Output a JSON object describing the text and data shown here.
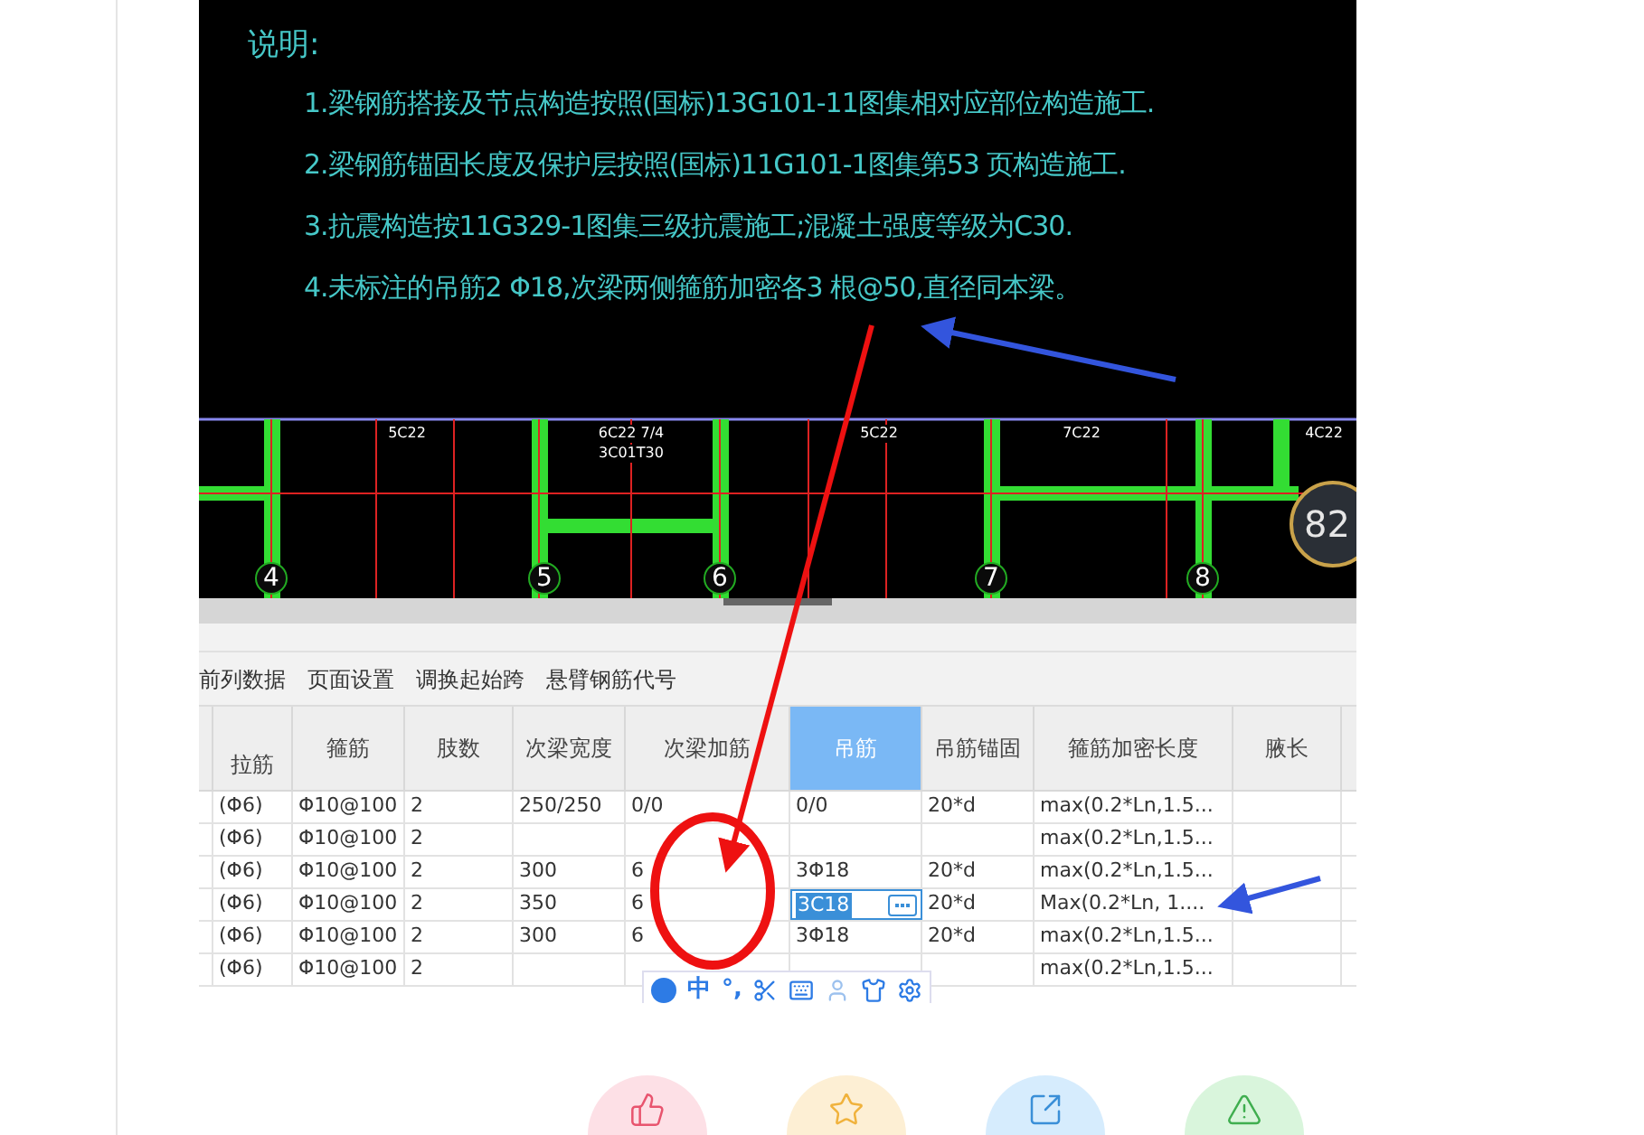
{
  "notes": {
    "title": "说明:",
    "items": [
      "1.梁钢筋搭接及节点构造按照(国标)13G101-11图集相对应部位构造施工.",
      "2.梁钢筋锚固长度及保护层按照(国标)11G101-1图集第53 页构造施工.",
      "3.抗震构造按11G329-1图集三级抗震施工;混凝土强度等级为C30.",
      "4.未标注的吊筋2 Φ18,次梁两侧箍筋加密各3 根@50,直径同本梁。"
    ]
  },
  "cad": {
    "labels": [
      "5C22",
      "6C22 7/4",
      "3C01T30",
      "5C22",
      "7C22",
      "4C22"
    ],
    "axes": [
      "4",
      "5",
      "6",
      "7",
      "8"
    ],
    "gauge": "82"
  },
  "toolbar": [
    "前列数据",
    "页面设置",
    "调换起始跨",
    "悬臂钢筋代号"
  ],
  "table": {
    "columns": [
      {
        "label": "拉筋",
        "selected": false
      },
      {
        "label": "箍筋",
        "selected": false
      },
      {
        "label": "肢数",
        "selected": false
      },
      {
        "label": "次梁宽度",
        "selected": false
      },
      {
        "label": "次梁加筋",
        "selected": false
      },
      {
        "label": "吊筋",
        "selected": true
      },
      {
        "label": "吊筋锚固",
        "selected": false
      },
      {
        "label": "箍筋加密长度",
        "selected": false
      },
      {
        "label": "腋长",
        "selected": false
      }
    ],
    "rows": [
      {
        "editing": false,
        "cells": [
          "(Φ6)",
          "Φ10@100",
          "2",
          "250/250",
          "0/0",
          "0/0",
          "20*d",
          "max(0.2*Ln,1.5...",
          null
        ]
      },
      {
        "editing": false,
        "cells": [
          "(Φ6)",
          "Φ10@100",
          "2",
          null,
          null,
          null,
          null,
          "max(0.2*Ln,1.5...",
          null
        ]
      },
      {
        "editing": false,
        "cells": [
          "(Φ6)",
          "Φ10@100",
          "2",
          "300",
          "6",
          "3Φ18",
          "20*d",
          "max(0.2*Ln,1.5...",
          null
        ]
      },
      {
        "editing": true,
        "cells": [
          "(Φ6)",
          "Φ10@100",
          "2",
          "350",
          "6",
          "3C18",
          "20*d",
          "Max(0.2*Ln, 1....",
          null
        ]
      },
      {
        "editing": false,
        "cells": [
          "(Φ6)",
          "Φ10@100",
          "2",
          "300",
          "6",
          "3Φ18",
          "20*d",
          "max(0.2*Ln,1.5...",
          null
        ]
      },
      {
        "editing": false,
        "cells": [
          "(Φ6)",
          "Φ10@100",
          "2",
          null,
          null,
          null,
          null,
          "max(0.2*Ln,1.5...",
          null
        ]
      }
    ]
  },
  "ime": {
    "mode": "中",
    "punctuation": "°,"
  },
  "actions": [
    {
      "kind": "like"
    },
    {
      "kind": "favorite"
    },
    {
      "kind": "share"
    },
    {
      "kind": "report"
    }
  ]
}
